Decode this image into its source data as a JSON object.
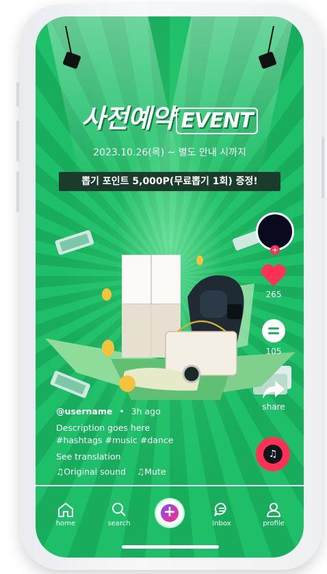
{
  "event": {
    "title_main": "사전예약",
    "title_event": "EVENT",
    "date": "2023.10.26(목) ~ 별도 안내 시까지",
    "promo": "뽑기 포인트 5,000P(무료뽑기 1회) 증정!"
  },
  "actions": {
    "likes": "265",
    "comments": "105",
    "share": "share"
  },
  "post": {
    "username": "@username",
    "time_ago": "3h ago",
    "description": "Description goes here",
    "hashtags": "#hashtags #music #dance",
    "see_translation": "See translation",
    "sound": "Original sound",
    "mute": "Mute"
  },
  "tabs": {
    "home": "home",
    "search": "search",
    "inbox": "inbox",
    "profile": "profile"
  },
  "icons": [
    "spotlight-icon",
    "heart-icon",
    "comment-icon",
    "share-icon",
    "music-disc-icon",
    "home-icon",
    "search-icon",
    "plus-icon",
    "inbox-icon",
    "profile-icon",
    "music-note-icon",
    "mute-icon"
  ],
  "colors": {
    "background_green": "#1cb564",
    "promo_bar": "#1b3b2c",
    "heart_red": "#ff3156",
    "music_button": "#ff3156"
  }
}
